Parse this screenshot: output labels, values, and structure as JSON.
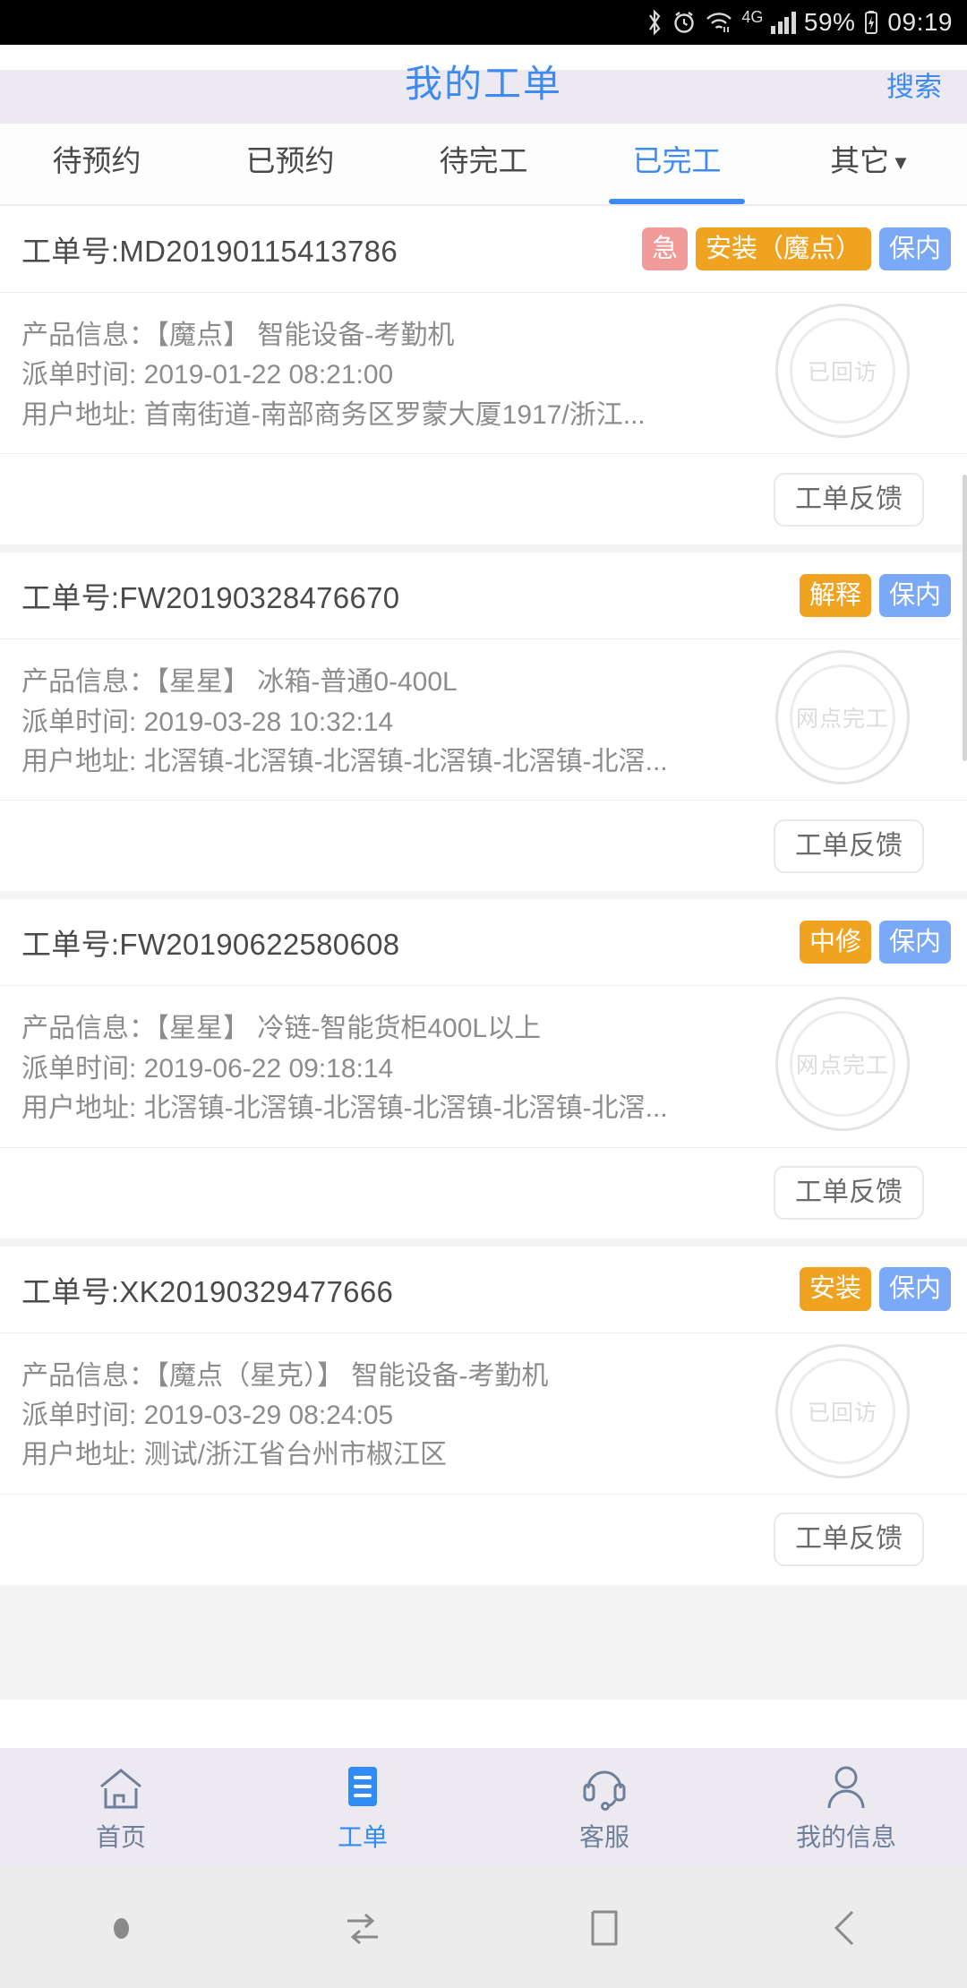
{
  "status_bar": {
    "bluetooth_icon": "bluetooth-icon",
    "alarm_icon": "alarm-icon",
    "wifi_icon": "wifi-icon",
    "network_label": "4G",
    "signal_icon": "signal-bars-icon",
    "battery_percent": "59%",
    "battery_icon": "battery-charging-icon",
    "time": "09:19"
  },
  "header": {
    "title": "我的工单",
    "search_label": "搜索",
    "accent_color": "#3d8bf2"
  },
  "tabs": [
    {
      "label": "待预约",
      "active": false
    },
    {
      "label": "已预约",
      "active": false
    },
    {
      "label": "待完工",
      "active": false
    },
    {
      "label": "已完工",
      "active": true
    },
    {
      "label": "其它",
      "active": false,
      "caret": "▼"
    }
  ],
  "labels": {
    "order_no_prefix": "工单号:",
    "product_prefix": "产品信息：",
    "dispatch_prefix": "派单时间: ",
    "address_prefix": "用户地址: ",
    "feedback_button": "工单反馈"
  },
  "orders": [
    {
      "order_no": "工单号:MD20190115413786",
      "badges": [
        {
          "text": "急",
          "color": "#f09a9a",
          "kind": "urgent"
        },
        {
          "text": "安装（魔点）",
          "color": "#f0a321",
          "kind": "orange"
        },
        {
          "text": "保内",
          "color": "#7aa9f7",
          "kind": "blue"
        }
      ],
      "product": "产品信息：【魔点】 智能设备-考勤机",
      "dispatch_time": "派单时间: 2019-01-22 08:21:00",
      "address": "用户地址: 首南街道-南部商务区罗蒙大厦1917/浙江...",
      "stamp": "已回访",
      "feedback_button": "工单反馈"
    },
    {
      "order_no": "工单号:FW20190328476670",
      "badges": [
        {
          "text": "解释",
          "color": "#f0a321",
          "kind": "orange"
        },
        {
          "text": "保内",
          "color": "#7aa9f7",
          "kind": "blue"
        }
      ],
      "product": "产品信息：【星星】 冰箱-普通0-400L",
      "dispatch_time": "派单时间: 2019-03-28 10:32:14",
      "address": "用户地址: 北滘镇-北滘镇-北滘镇-北滘镇-北滘镇-北滘...",
      "stamp": "网点完工",
      "feedback_button": "工单反馈"
    },
    {
      "order_no": "工单号:FW20190622580608",
      "badges": [
        {
          "text": "中修",
          "color": "#f0a321",
          "kind": "orange"
        },
        {
          "text": "保内",
          "color": "#7aa9f7",
          "kind": "blue"
        }
      ],
      "product": "产品信息：【星星】 冷链-智能货柜400L以上",
      "dispatch_time": "派单时间: 2019-06-22 09:18:14",
      "address": "用户地址: 北滘镇-北滘镇-北滘镇-北滘镇-北滘镇-北滘...",
      "stamp": "网点完工",
      "feedback_button": "工单反馈"
    },
    {
      "order_no": "工单号:XK20190329477666",
      "badges": [
        {
          "text": "安装",
          "color": "#f0a321",
          "kind": "orange"
        },
        {
          "text": "保内",
          "color": "#7aa9f7",
          "kind": "blue"
        }
      ],
      "product": "产品信息：【魔点（星克）】 智能设备-考勤机",
      "dispatch_time": "派单时间: 2019-03-29 08:24:05",
      "address": "用户地址: 测试/浙江省台州市椒江区",
      "stamp": "已回访",
      "feedback_button": "工单反馈"
    }
  ],
  "bottom_nav": [
    {
      "label": "首页",
      "icon": "home-icon",
      "active": false
    },
    {
      "label": "工单",
      "icon": "list-document-icon",
      "active": true
    },
    {
      "label": "客服",
      "icon": "headset-support-icon",
      "active": false
    },
    {
      "label": "我的信息",
      "icon": "person-icon",
      "active": false
    }
  ],
  "android_nav": [
    {
      "icon": "dot-indicator-icon"
    },
    {
      "icon": "split-screen-icon"
    },
    {
      "icon": "recents-square-icon"
    },
    {
      "icon": "back-arrow-icon"
    }
  ]
}
